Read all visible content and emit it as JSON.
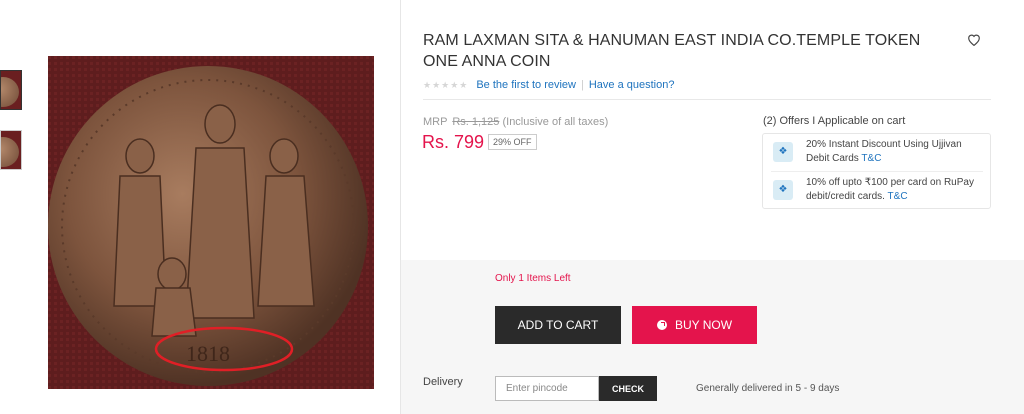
{
  "product": {
    "title": "RAM LAXMAN SITA & HANUMAN EAST INDIA CO.TEMPLE TOKEN ONE ANNA COIN",
    "image_alt_year": "1818"
  },
  "rating": {
    "stars": "★★★★★",
    "review_link": "Be the first to review",
    "separator": "|",
    "question_link": "Have a question?"
  },
  "pricing": {
    "mrp_label": "MRP",
    "mrp_value": "Rs. 1,125",
    "tax_note": "(Inclusive of all taxes)",
    "price": "Rs. 799",
    "discount": "29% OFF"
  },
  "offers": {
    "title": "(2) Offers I Applicable on cart",
    "items": [
      {
        "text": "20% Instant Discount Using Ujjivan Debit Cards",
        "link": "T&C"
      },
      {
        "text": "10% off upto ₹100 per card on RuPay debit/credit cards.",
        "link": "T&C"
      }
    ]
  },
  "stock": {
    "text": "Only 1 Items Left"
  },
  "actions": {
    "add_to_cart": "ADD TO CART",
    "buy_now": "BUY NOW"
  },
  "delivery": {
    "label": "Delivery",
    "pincode_placeholder": "Enter pincode",
    "check_label": "CHECK",
    "eta": "Generally delivered in 5 - 9 days"
  },
  "colors": {
    "accent_pink": "#e4144c",
    "dark_button": "#2a2a2a",
    "link_blue": "#1e73be"
  },
  "icons": {
    "wishlist": "heart-outline-icon",
    "offer": "tag-icon",
    "buy_now": "lightning-icon"
  }
}
